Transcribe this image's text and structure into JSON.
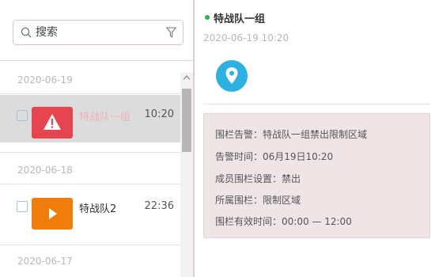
{
  "search": {
    "placeholder": "搜索"
  },
  "groups": [
    {
      "date": "2020-06-19",
      "items": [
        {
          "name": "特战队一组",
          "time": "10:20",
          "icon": "alert-icon",
          "color": "#e4454f",
          "selected": true
        }
      ]
    },
    {
      "date": "2020-06-18",
      "items": [
        {
          "name": "特战队2",
          "time": "22:36",
          "icon": "video-play-icon",
          "color": "#f07d0a",
          "selected": false
        }
      ]
    },
    {
      "date": "2020-06-17",
      "items": []
    }
  ],
  "detail": {
    "title": "特战队一组",
    "time": "2020-06-19 10:20",
    "status_color": "#26b847",
    "location_icon": "map-pin-icon",
    "lines": [
      "围栏告警：特战队一组禁出限制区域",
      "告警时间：06月19日10:20",
      "成员围栏设置：禁出",
      "所属围栏：限制区域",
      "围栏有效时间：00:00 — 12:00"
    ]
  }
}
